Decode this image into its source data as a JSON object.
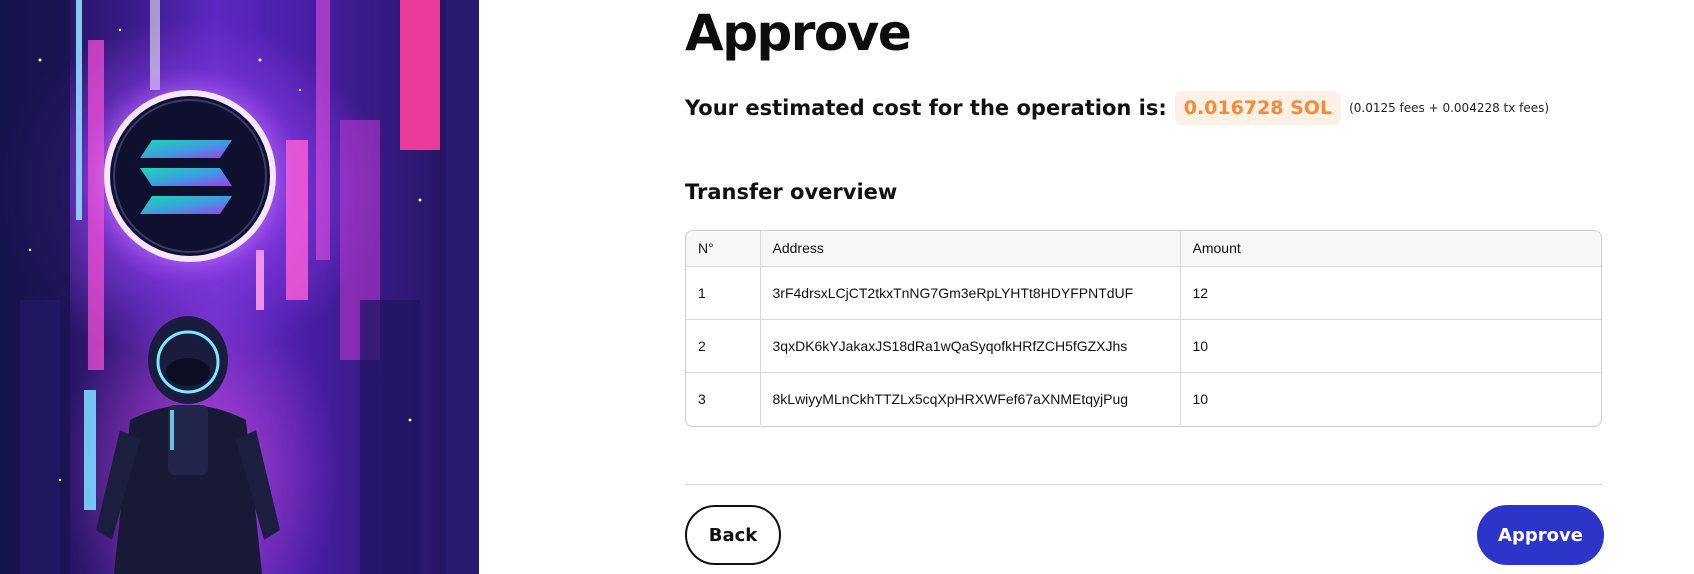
{
  "page": {
    "title": "Approve"
  },
  "cost": {
    "label": "Your estimated cost for the operation is:",
    "amount": "0.016728 SOL",
    "breakdown": "(0.0125 fees + 0.004228 tx fees)",
    "accent_color": "#f58a3a"
  },
  "transfer": {
    "section_title": "Transfer overview",
    "columns": [
      "N°",
      "Address",
      "Amount"
    ],
    "rows": [
      {
        "n": "1",
        "address": "3rF4drsxLCjCT2tkxTnNG7Gm3eRpLYHTt8HDYFPNTdUF",
        "amount": "12"
      },
      {
        "n": "2",
        "address": "3qxDK6kYJakaxJS18dRa1wQaSyqofkHRfZCH5fGZXJhs",
        "amount": "10"
      },
      {
        "n": "3",
        "address": "8kLwiyyMLnCkhTTZLx5cqXpHRXWFef67aXNMEtqyjPug",
        "amount": "10"
      }
    ]
  },
  "actions": {
    "back_label": "Back",
    "approve_label": "Approve",
    "approve_color": "#2d34c9"
  },
  "artwork": {
    "subject": "astronaut-solana-illustration"
  }
}
